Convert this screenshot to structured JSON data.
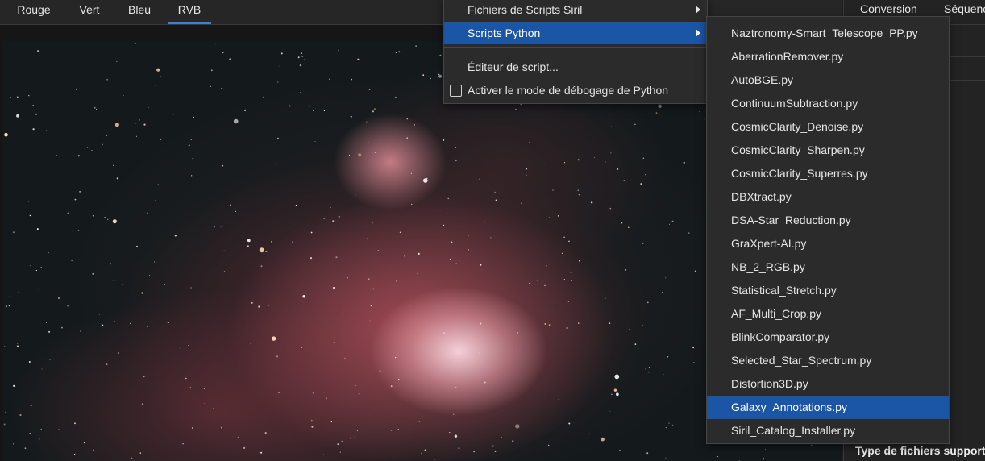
{
  "channel_tabs": [
    {
      "label": "Rouge"
    },
    {
      "label": "Vert"
    },
    {
      "label": "Bleu"
    },
    {
      "label": "RVB",
      "active": true
    }
  ],
  "right_panel": {
    "tabs": [
      {
        "label": "Conversion"
      },
      {
        "label": "Séquence"
      }
    ],
    "footer_label": "Type de fichiers support"
  },
  "scripts_menu": {
    "items": [
      {
        "label": "Fichiers de Scripts Siril",
        "has_submenu": true
      },
      {
        "label": "Scripts Python",
        "has_submenu": true,
        "highlighted": true
      },
      {
        "label": "Éditeur de script..."
      },
      {
        "label": "Activer le mode de débogage de Python",
        "checkbox": true,
        "checked": false
      }
    ]
  },
  "python_submenu": {
    "items": [
      "Naztronomy-Smart_Telescope_PP.py",
      "AberrationRemover.py",
      "AutoBGE.py",
      "ContinuumSubtraction.py",
      "CosmicClarity_Denoise.py",
      "CosmicClarity_Sharpen.py",
      "CosmicClarity_Superres.py",
      "DBXtract.py",
      "DSA-Star_Reduction.py",
      "GraXpert-AI.py",
      "NB_2_RGB.py",
      "Statistical_Stretch.py",
      "AF_Multi_Crop.py",
      "BlinkComparator.py",
      "Selected_Star_Spectrum.py",
      "Distortion3D.py",
      "Galaxy_Annotations.py",
      "Siril_Catalog_Installer.py"
    ],
    "highlighted_index": 16
  },
  "colors": {
    "accent": "#1b55a5",
    "tab_underline": "#3d7fd0"
  }
}
